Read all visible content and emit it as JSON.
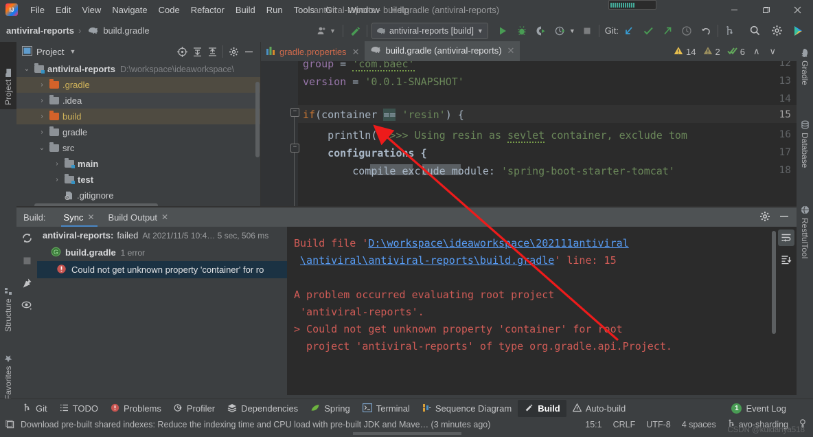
{
  "window": {
    "title": "antiviral-reports - build.gradle (antiviral-reports)",
    "minimize": "—",
    "maximize": "❐",
    "close": "✕"
  },
  "menubar": {
    "items": [
      {
        "label": "File"
      },
      {
        "label": "Edit"
      },
      {
        "label": "View"
      },
      {
        "label": "Navigate"
      },
      {
        "label": "Code"
      },
      {
        "label": "Refactor"
      },
      {
        "label": "Build"
      },
      {
        "label": "Run"
      },
      {
        "label": "Tools"
      },
      {
        "label": "Git"
      },
      {
        "label": "Window"
      },
      {
        "label": "Help"
      }
    ]
  },
  "toolbar": {
    "breadcrumb": {
      "project": "antiviral-reports",
      "separator": "›",
      "file": "build.gradle"
    },
    "run_config": {
      "label": "antiviral-reports [build]",
      "chevron": "▾"
    },
    "git_label": "Git:",
    "icons": {
      "avatar": "avatar-icon",
      "build_hammer": "hammer-icon",
      "run": "run-icon",
      "debug": "debug-icon",
      "run_coverage": "run-with-coverage-icon",
      "profile": "profile-icon",
      "stop": "stop-icon",
      "update": "git-update-icon",
      "commit": "git-commit-icon",
      "push": "git-push-icon",
      "history": "git-history-icon",
      "rollback": "git-rollback-icon",
      "branch": "git-branch-icon",
      "search": "search-icon",
      "settings": "gear-icon",
      "ide_help": "ide-assistant-icon"
    }
  },
  "left_strip": {
    "tabs": [
      "Project",
      "Structure",
      "Favorites"
    ]
  },
  "right_strip": {
    "tabs": [
      "Gradle",
      "Database",
      "RestfulTool"
    ]
  },
  "project_panel": {
    "title": "Project",
    "chevron": "▾",
    "toolbar_icons": [
      "locate-icon",
      "expand-all-icon",
      "collapse-all-icon",
      "gear-icon",
      "hide-icon"
    ],
    "tree": [
      {
        "label": "antiviral-reports",
        "path": "D:\\workspace\\ideaworkspace\\",
        "depth": 0,
        "arrow": "⌄",
        "folder": "module",
        "bold": true,
        "highlight": "none"
      },
      {
        "label": ".gradle",
        "depth": 1,
        "arrow": "›",
        "folder": "orange",
        "highlight": "gold"
      },
      {
        "label": ".idea",
        "depth": 1,
        "arrow": "›",
        "folder": "grey",
        "highlight": "dark"
      },
      {
        "label": "build",
        "depth": 1,
        "arrow": "›",
        "folder": "orange",
        "highlight": "gold"
      },
      {
        "label": "gradle",
        "depth": 1,
        "arrow": "›",
        "folder": "grey",
        "highlight": "none"
      },
      {
        "label": "src",
        "depth": 1,
        "arrow": "⌄",
        "folder": "grey",
        "highlight": "none"
      },
      {
        "label": "main",
        "depth": 2,
        "arrow": "›",
        "folder": "module",
        "bold": true,
        "highlight": "none"
      },
      {
        "label": "test",
        "depth": 2,
        "arrow": "›",
        "folder": "module",
        "bold": true,
        "highlight": "none"
      },
      {
        "label": ".gitignore",
        "depth": 2,
        "arrow": "",
        "folder": "file",
        "highlight": "none"
      }
    ]
  },
  "editor": {
    "tabs": [
      {
        "label": "gradle.properties",
        "icon": "gradle-properties-icon",
        "active": false,
        "close": "✕"
      },
      {
        "label": "build.gradle (antiviral-reports)",
        "icon": "gradle-elephant-icon",
        "active": true,
        "close": "✕"
      }
    ],
    "inspections": {
      "warnings": "14",
      "weak_warnings": "2",
      "typos": "6",
      "up": "∧",
      "down": "∨"
    },
    "gradle_notification": {
      "icon": "gradle-reload-icon",
      "close": "✕"
    },
    "lines": [
      {
        "no": "12",
        "text": "group = 'com.baec'"
      },
      {
        "no": "13",
        "text": "version = '0.0.1-SNAPSHOT'"
      },
      {
        "no": "14",
        "text": ""
      },
      {
        "no": "15",
        "text": "if(container == 'resin') {",
        "current": true
      },
      {
        "no": "16",
        "text": "    println(\">>>> Using resin as sevlet container, exclude tom"
      },
      {
        "no": "17",
        "text": "    configurations {"
      },
      {
        "no": "18",
        "text": "        compile exclude module: 'spring-boot-starter-tomcat'"
      }
    ]
  },
  "build_window": {
    "label": "Build:",
    "tabs": [
      {
        "label": "Sync",
        "selected": true,
        "close": "✕"
      },
      {
        "label": "Build Output",
        "selected": false,
        "close": "✕"
      }
    ],
    "header_icons": [
      "gear-icon",
      "hide-icon"
    ],
    "gutter_icons": [
      "rerun-icon",
      "stop-icon",
      "pin-icon",
      "eye-icon"
    ],
    "tree": [
      {
        "label": "antiviral-reports:",
        "status": "failed",
        "meta": "At 2021/11/5 10:4… 5 sec, 506 ms",
        "level": 0,
        "icon": "none"
      },
      {
        "label": "build.gradle",
        "meta": "1 error",
        "level": 1,
        "icon": "gradle-file-icon"
      },
      {
        "label": "Could not get unknown property 'container' for ro",
        "level": 2,
        "icon": "error-icon",
        "selected": true
      }
    ],
    "console_lines": [
      {
        "segments": [
          {
            "t": "Build file '",
            "k": "text"
          },
          {
            "t": "D:\\workspace\\ideaworkspace\\202111antiviral",
            "k": "link"
          }
        ]
      },
      {
        "segments": [
          {
            "t": " ",
            "k": "text"
          },
          {
            "t": "\\antiviral\\antiviral-reports\\build.gradle",
            "k": "link"
          },
          {
            "t": "' line: 15",
            "k": "text"
          }
        ]
      },
      {
        "segments": [
          {
            "t": "",
            "k": "text"
          }
        ]
      },
      {
        "segments": [
          {
            "t": "A problem occurred evaluating root project",
            "k": "text"
          }
        ]
      },
      {
        "segments": [
          {
            "t": " 'antiviral-reports'.",
            "k": "text"
          }
        ]
      },
      {
        "segments": [
          {
            "t": "> Could not get unknown property 'container' for root",
            "k": "text"
          }
        ]
      },
      {
        "segments": [
          {
            "t": "  project 'antiviral-reports' of type org.gradle.api.Project.",
            "k": "text"
          }
        ]
      }
    ],
    "console_tool_icons": [
      "soft-wrap-icon",
      "scroll-to-end-icon"
    ]
  },
  "bottom_bar": {
    "items": [
      {
        "label": "Git",
        "icon": "git-branch-icon",
        "selected": false
      },
      {
        "label": "TODO",
        "icon": "todo-icon",
        "selected": false
      },
      {
        "label": "Problems",
        "icon": "problems-icon",
        "selected": false
      },
      {
        "label": "Profiler",
        "icon": "profiler-icon",
        "selected": false
      },
      {
        "label": "Dependencies",
        "icon": "dependencies-icon",
        "selected": false
      },
      {
        "label": "Spring",
        "icon": "spring-leaf-icon",
        "selected": false
      },
      {
        "label": "Terminal",
        "icon": "terminal-icon",
        "selected": false
      },
      {
        "label": "Sequence Diagram",
        "icon": "sequence-diagram-icon",
        "selected": false
      },
      {
        "label": "Build",
        "icon": "hammer-icon",
        "selected": true
      },
      {
        "label": "Auto-build",
        "icon": "warning-icon",
        "selected": false
      }
    ],
    "event_log": {
      "label": "Event Log",
      "count": "1"
    }
  },
  "status_bar": {
    "message": "Download pre-built shared indexes: Reduce the indexing time and CPU load with pre-built JDK and Mave… (3 minutes ago)",
    "icon": "notification-icon",
    "caret": "15:1",
    "line_separator": "CRLF",
    "encoding": "UTF-8",
    "indent": "4 spaces",
    "branch": "avo-sharding",
    "branch_icon": "git-branch-icon",
    "inspection_icon": "inspections-icon"
  },
  "watermark": "CSDN @kuidanya518",
  "colors": {
    "accent_blue": "#4a88c7",
    "error_red": "#cf5b56",
    "link_blue": "#589df6",
    "warning_yellow": "#e8bf6a",
    "green": "#6a8759",
    "panel_bg": "#3c3f41",
    "editor_bg": "#2b2b2b",
    "annotation_arrow": "#ee1b1b"
  }
}
